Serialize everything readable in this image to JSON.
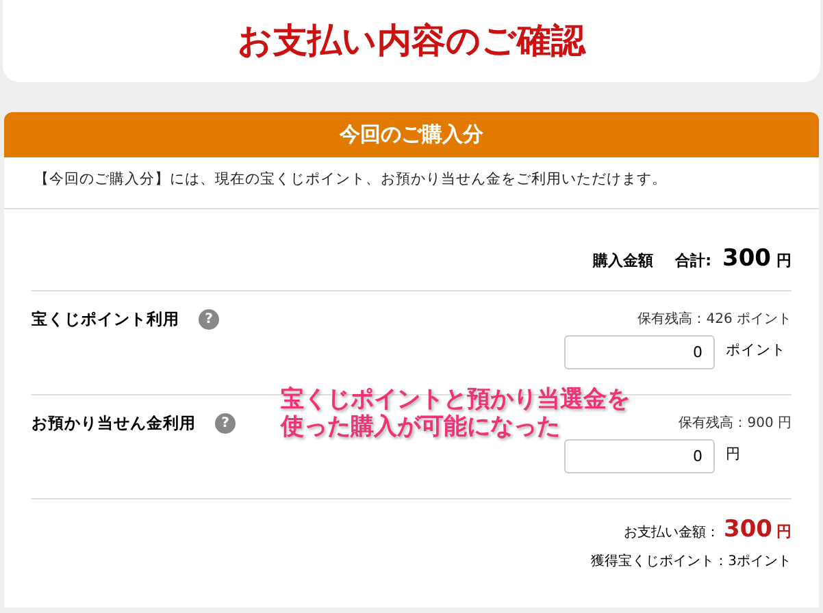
{
  "title": "お支払い内容のご確認",
  "section": {
    "header": "今回のご購入分",
    "intro": "【今回のご購入分】には、現在の宝くじポイント、お預かり当せん金をご利用いただけます。",
    "total": {
      "label": "購入金額",
      "sum_label": "合計:",
      "amount": "300",
      "unit": "円"
    },
    "uses": [
      {
        "label": "宝くじポイント利用",
        "help": "?",
        "balance": "保有残高：426 ポイント",
        "value": "0",
        "unit": "ポイント"
      },
      {
        "label": "お預かり当せん金利用",
        "help": "?",
        "balance": "保有残高：900 円",
        "value": "0",
        "unit": "円"
      }
    ],
    "payment": {
      "label": "お支払い金額：",
      "amount": "300",
      "unit": "円"
    },
    "earned": "獲得宝くじポイント：3ポイント"
  },
  "annotation": [
    "宝くじポイントと預かり当選金を",
    "使った購入が可能になった"
  ]
}
